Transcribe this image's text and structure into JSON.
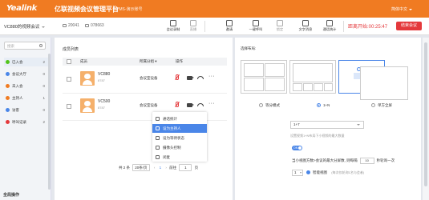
{
  "header": {
    "logo": "Yealink",
    "title": "亿联视频会议管理平台",
    "subtitle": "YMS-演示账号",
    "language": "简体中文"
  },
  "meeting": {
    "name": "VC880的视频会议",
    "participants": "20041",
    "id": "078663",
    "duration_label": "距离开始:",
    "duration": "00:25:47",
    "end_button": "结束会议"
  },
  "toolbar": [
    {
      "label": "会议录制",
      "enabled": true,
      "icon": "record-icon"
    },
    {
      "label": "直播",
      "enabled": false,
      "icon": "live-icon"
    },
    {
      "label": "邀请",
      "enabled": true,
      "icon": "invite-icon"
    },
    {
      "label": "一键呼叫",
      "enabled": true,
      "icon": "call-icon"
    },
    {
      "label": "锁定",
      "enabled": false,
      "icon": "lock-icon"
    },
    {
      "label": "文字消息",
      "enabled": true,
      "icon": "message-icon"
    },
    {
      "label": "通话统计",
      "enabled": true,
      "icon": "stats-icon"
    }
  ],
  "sidebar": {
    "search_placeholder": "搜索",
    "items": [
      {
        "label": "已入会",
        "count": "2",
        "color": "#52c41a"
      },
      {
        "label": "会议大厅",
        "count": "0",
        "color": "#4a86e8"
      },
      {
        "label": "未入会",
        "count": "0",
        "color": "#f07b22"
      },
      {
        "label": "主持人",
        "count": "1",
        "color": "#f07b22"
      },
      {
        "label": "访客",
        "count": "0",
        "color": "#4a86e8"
      },
      {
        "label": "呼叫记录",
        "count": "2",
        "color": "#e4393c"
      }
    ],
    "footer": "全局操作"
  },
  "list": {
    "title": "成员列表",
    "headers": [
      "成员",
      "所属分组",
      "操作"
    ],
    "rows": [
      {
        "name": "VC880",
        "sub": "8787",
        "group": "会议室设备"
      },
      {
        "name": "VC500",
        "sub": "8787",
        "group": "会议室设备"
      }
    ],
    "menu": [
      "通话统计",
      "设为主持人",
      "设为等待状态",
      "摄像头控制",
      "闭麦"
    ],
    "pager": {
      "total": "共 2 条",
      "per_page": "20条/页",
      "current": "1",
      "goto_label": "前往",
      "goto_value": "1",
      "page_unit": "页"
    }
  },
  "layout_panel": {
    "label": "选择布局:",
    "modes": [
      "等分模式",
      "1+N",
      "单方全屏"
    ],
    "selected_mode": "1+N",
    "select_value": "1+7",
    "hint1": "设置视频1+N布局下小视频的最大数量",
    "toggle_label": "ON",
    "polling_note_pre": "当小视图方数>会议的最大分屏数, 则每隔",
    "polling_value": "10",
    "polling_note_post": "秒轮询一次",
    "row2_select": "1",
    "row2_label": "智能视图",
    "row2_hint": "(每次仅轮询1名与会者)"
  }
}
